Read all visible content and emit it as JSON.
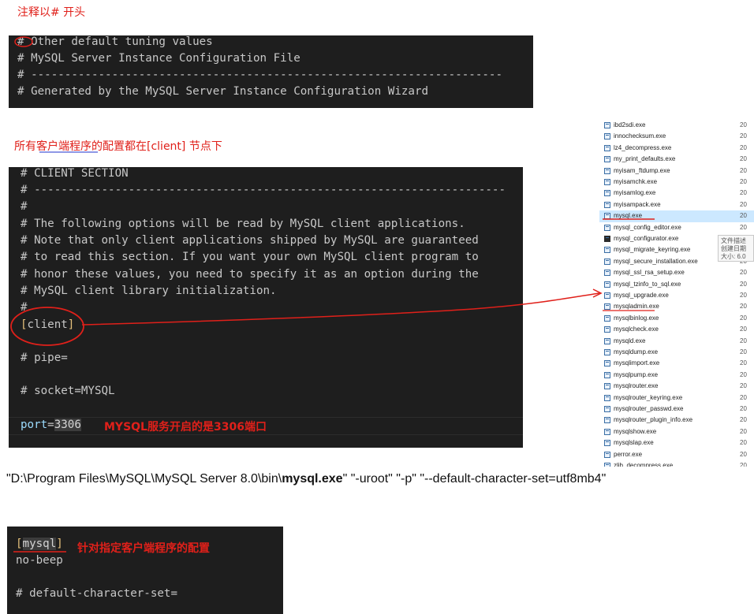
{
  "annotations": {
    "comment_note": "注释以# 开头",
    "client_note": "所有客户端程序的配置都在[client] 节点下",
    "port_note": "MYSQL服务开启的是3306端口",
    "mysql_note": "针对指定客户端程序的配置"
  },
  "code_block_1": {
    "lines": [
      "# Other default tuning values",
      "# MySQL Server Instance Configuration File",
      "# ----------------------------------------------------------------------",
      "# Generated by the MySQL Server Instance Configuration Wizard"
    ]
  },
  "code_block_2": {
    "comment_lines": [
      "# CLIENT SECTION",
      "# ----------------------------------------------------------------------",
      "#",
      "# The following options will be read by MySQL client applications.",
      "# Note that only client applications shipped by MySQL are guaranteed",
      "# to read this section. If you want your own MySQL client program to",
      "# honor these values, you need to specify it as an option during the",
      "# MySQL client library initialization.",
      "#"
    ],
    "open_bracket": "[",
    "section_name": "client",
    "close_bracket": "]",
    "pipe_line": "# pipe=",
    "socket_line": "# socket=MYSQL",
    "port_key": "port",
    "port_eq": "=",
    "port_value": "3306"
  },
  "command_line": {
    "prefix": "\"D:\\Program Files\\MySQL\\MySQL Server 8.0\\bin\\",
    "exe": "mysql.exe",
    "suffix": "\" \"-uroot\" \"-p\" \"--default-character-set=utf8mb4\""
  },
  "code_block_3": {
    "open_bracket": "[",
    "section_name": "mysql",
    "close_bracket": "]",
    "line2": "no-beep",
    "line4": "# default-character-set="
  },
  "explorer": {
    "files": [
      "ibd2sdi.exe",
      "innochecksum.exe",
      "lz4_decompress.exe",
      "my_print_defaults.exe",
      "myisam_ftdump.exe",
      "myisamchk.exe",
      "myisamlog.exe",
      "myisampack.exe",
      "mysql.exe",
      "mysql_config_editor.exe",
      "mysql_configurator.exe",
      "mysql_migrate_keyring.exe",
      "mysql_secure_installation.exe",
      "mysql_ssl_rsa_setup.exe",
      "mysql_tzinfo_to_sql.exe",
      "mysql_upgrade.exe",
      "mysqladmin.exe",
      "mysqlbinlog.exe",
      "mysqlcheck.exe",
      "mysqld.exe",
      "mysqldump.exe",
      "mysqlimport.exe",
      "mysqlpump.exe",
      "mysqlrouter.exe",
      "mysqlrouter_keyring.exe",
      "mysqlrouter_passwd.exe",
      "mysqlrouter_plugin_info.exe",
      "mysqlshow.exe",
      "mysqlslap.exe",
      "perror.exe",
      "zlib_decompress.exe"
    ],
    "date_prefix": "20",
    "selected_file": "mysql.exe",
    "tooltip_lines": [
      "文件描述",
      "创建日期",
      "大小: 6.0"
    ]
  },
  "colors": {
    "annotation_red": "#e0201a",
    "code_bg": "#1e1e1e",
    "bracket": "#e5c07b",
    "key": "#9cdcfe",
    "selected_row": "#cce8ff"
  }
}
